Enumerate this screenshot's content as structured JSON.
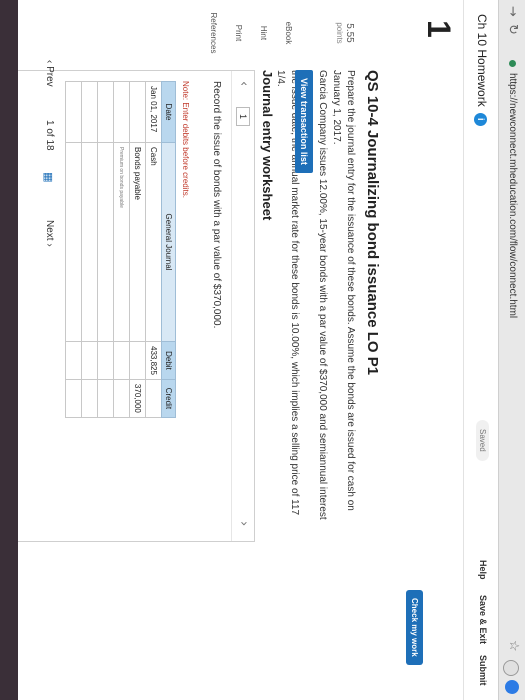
{
  "browser": {
    "url": "https://newconnect.mheducation.com/flow/connect.html",
    "back_icon": "arrow-left",
    "forward_icon": "arrow-right",
    "reload_icon": "reload"
  },
  "header": {
    "title": "Ch 10 Homework",
    "info": "i",
    "saved": "Saved",
    "help": "Help",
    "save_exit": "Save & Exit",
    "submit": "Submit"
  },
  "sidebar": {
    "question_number": "1",
    "points": "5.55",
    "points_label": "points",
    "links": [
      "eBook",
      "Hint",
      "Print",
      "References"
    ]
  },
  "question": {
    "check_button": "Check my work",
    "title": "QS 10-4 Journalizing bond issuance LO P1",
    "body_line1": "Prepare the journal entry for the issuance of these bonds. Assume the bonds are issued for cash on January 1, 2017.",
    "body_line2": "Garcia Company issues 12.00%, 15-year bonds with a par value of $370,000 and semiannual interest payments. On",
    "body_line3": "the issue date, the annual market rate for these bonds is 10.00%, which implies a selling price of 117 1/4.",
    "view_button": "View transaction list"
  },
  "worksheet": {
    "title": "Journal entry worksheet",
    "page": "1",
    "instruction": "Record the issue of bonds with a par value of $370,000.",
    "note": "Note: Enter debits before credits.",
    "table_title": "General Journal",
    "columns": [
      "Date",
      "General Journal",
      "Debit",
      "Credit"
    ],
    "rows": [
      {
        "date": "Jan 01, 2017",
        "account": "Cash",
        "debit": "433,825",
        "credit": ""
      },
      {
        "date": "",
        "account": "Bonds payable",
        "debit": "",
        "credit": "370,000"
      },
      {
        "date": "",
        "account": "Premium on bonds payable",
        "debit": "",
        "credit": ""
      },
      {
        "date": "",
        "account": "",
        "debit": "",
        "credit": ""
      },
      {
        "date": "",
        "account": "",
        "debit": "",
        "credit": ""
      },
      {
        "date": "",
        "account": "",
        "debit": "",
        "credit": ""
      }
    ]
  },
  "pager": {
    "prev": "Prev",
    "current": "1",
    "of": "of 18",
    "next": "Next"
  },
  "colors": {
    "accent": "#1e6fb8",
    "table_header": "#b9d7ee"
  }
}
